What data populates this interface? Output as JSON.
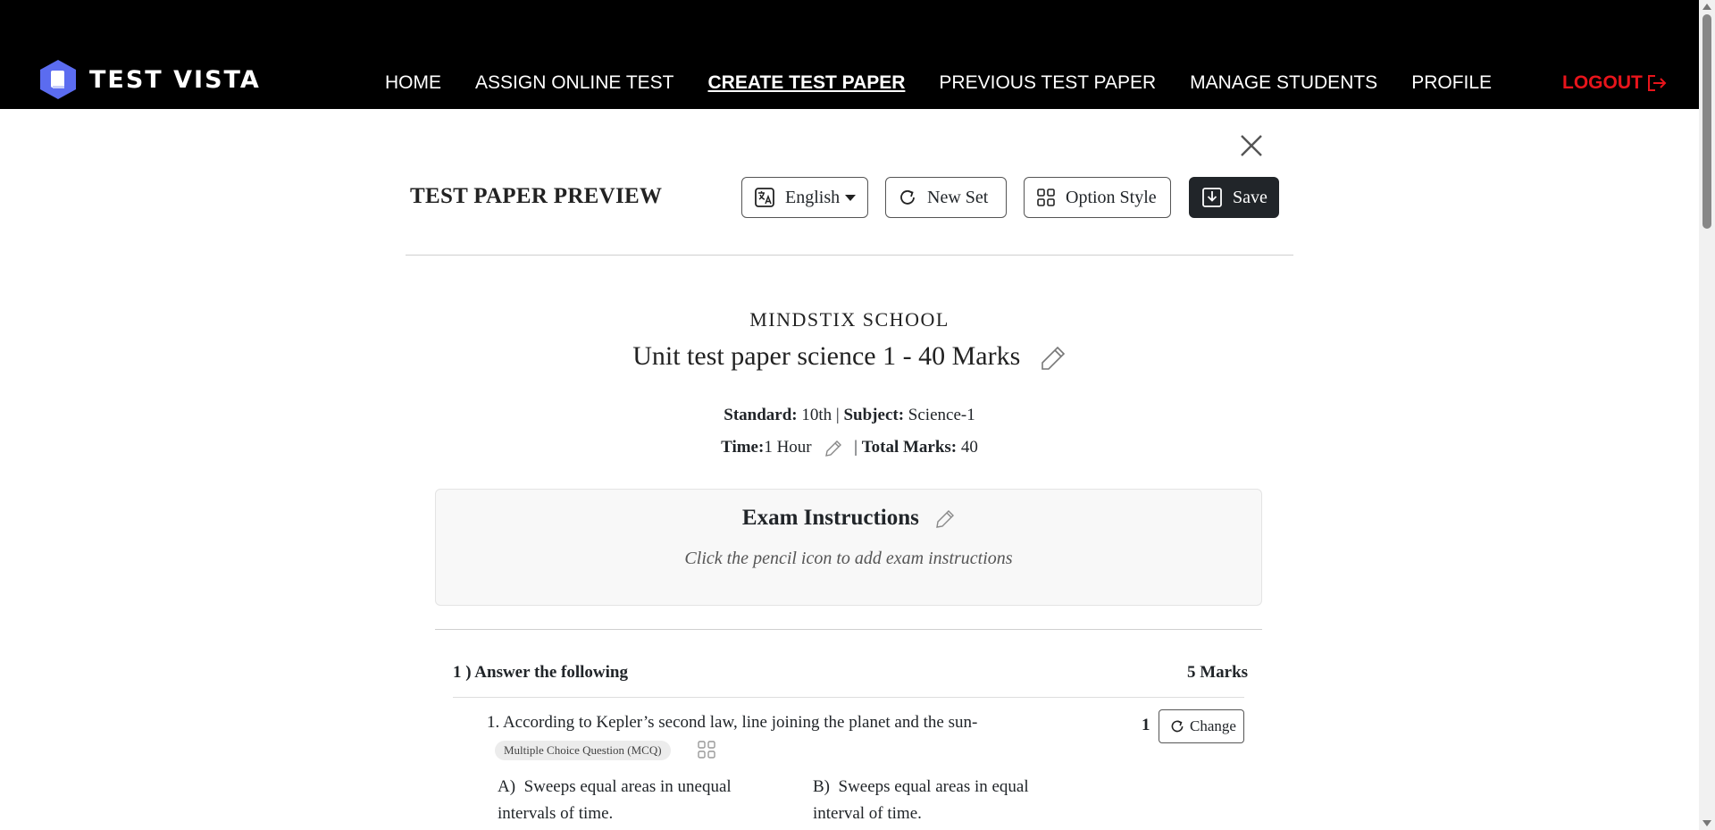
{
  "brand": {
    "name": "TEST VISTA"
  },
  "nav": {
    "items": [
      {
        "label": "HOME"
      },
      {
        "label": "ASSIGN ONLINE TEST"
      },
      {
        "label": "CREATE TEST PAPER"
      },
      {
        "label": "PREVIOUS TEST PAPER"
      },
      {
        "label": "MANAGE STUDENTS"
      },
      {
        "label": "PROFILE"
      }
    ],
    "active": "CREATE TEST PAPER",
    "logout_label": "LOGOUT"
  },
  "toolbar": {
    "title": "TEST PAPER PREVIEW",
    "language": "English",
    "new_set": "New Set",
    "option_style": "Option Style",
    "save": "Save"
  },
  "paper": {
    "school": "MINDSTIX SCHOOL",
    "title": "Unit test paper science 1 - 40 Marks",
    "standard_label": "Standard:",
    "standard": "10th",
    "subject_label": "Subject:",
    "subject": "Science-1",
    "time_label": "Time:",
    "time": "1 Hour",
    "total_marks_label": "Total Marks:",
    "total_marks": "40"
  },
  "instructions": {
    "title": "Exam Instructions",
    "hint": "Click the pencil icon to add exam instructions"
  },
  "section": {
    "title": "1 ) Answer the following",
    "marks": "5 Marks"
  },
  "question": {
    "text": "1. According to Kepler’s second law,  line joining the planet and the sun-",
    "marks": "1",
    "change_label": "Change",
    "type_badge": "Multiple Choice Question (MCQ)",
    "options": [
      {
        "label": "A)",
        "text": "Sweeps equal areas in unequal intervals of time."
      },
      {
        "label": "B)",
        "text": "Sweeps equal areas in equal interval of time."
      }
    ]
  },
  "colors": {
    "logout": "#e8141b",
    "brand_icon": "#5b6cf0",
    "save_bg": "#212529"
  }
}
